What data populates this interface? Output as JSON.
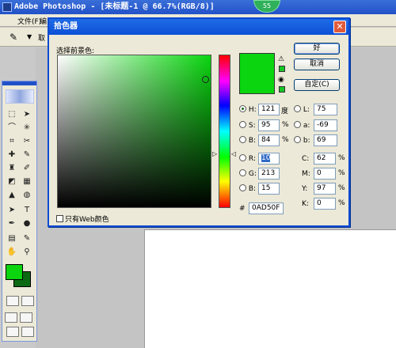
{
  "app": {
    "title": "Adobe Photoshop - [未标题-1 @ 66.7%(RGB/8)]",
    "badge": "55"
  },
  "menubar": {
    "file": "文件(F)",
    "edit": "编",
    "options_label": "取"
  },
  "dialog": {
    "title": "拾色器",
    "pick_label": "选择前景色:",
    "ok": "好",
    "cancel": "取消",
    "custom": "自定(C)",
    "web_only": "只有Web颜色",
    "new_color": "#0AD50F",
    "gamut_warning_icon": "alert-triangle-icon",
    "cube_icon": "web-cube-icon"
  },
  "hsb": {
    "h": {
      "label": "H:",
      "value": "121",
      "unit": "度",
      "selected": true
    },
    "s": {
      "label": "S:",
      "value": "95",
      "unit": "%"
    },
    "b": {
      "label": "B:",
      "value": "84",
      "unit": "%"
    }
  },
  "rgb": {
    "r": {
      "label": "R:",
      "value": "10"
    },
    "g": {
      "label": "G:",
      "value": "213"
    },
    "b": {
      "label": "B:",
      "value": "15"
    }
  },
  "lab": {
    "l": {
      "label": "L:",
      "value": "75"
    },
    "a": {
      "label": "a:",
      "value": "-69"
    },
    "b": {
      "label": "b:",
      "value": "69"
    }
  },
  "cmyk": {
    "c": {
      "label": "C:",
      "value": "62",
      "unit": "%"
    },
    "m": {
      "label": "M:",
      "value": "0",
      "unit": "%"
    },
    "y": {
      "label": "Y:",
      "value": "97",
      "unit": "%"
    },
    "k": {
      "label": "K:",
      "value": "0",
      "unit": "%"
    }
  },
  "hex": {
    "label": "#",
    "value": "0AD50F"
  },
  "colors": {
    "foreground": "#0AD50F",
    "background": "#0C6A12",
    "titlebar": "#0D4FD6"
  }
}
